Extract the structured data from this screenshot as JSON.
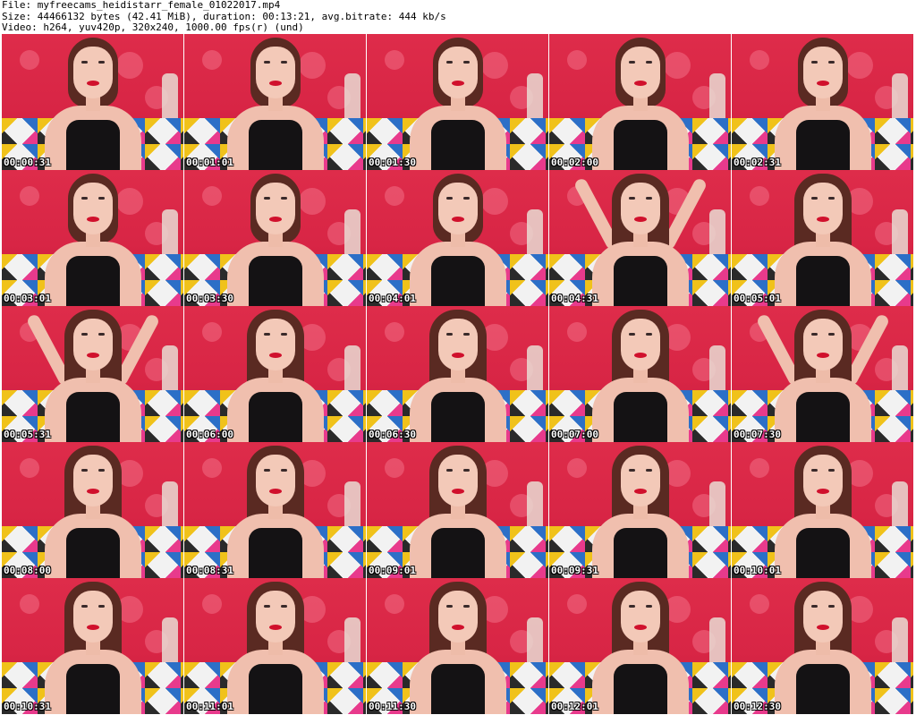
{
  "header": {
    "file_line": "File: myfreecams_heidistarr_female_01022017.mp4",
    "size_line": "Size: 44466132 bytes (42.41 MiB), duration: 00:13:21, avg.bitrate: 444 kb/s",
    "video_line": "Video: h264, yuv420p, 320x240, 1000.00 fps(r) (und)"
  },
  "thumbnails": [
    {
      "time": "00:00:31",
      "pose": "normal"
    },
    {
      "time": "00:01:01",
      "pose": "normal"
    },
    {
      "time": "00:01:30",
      "pose": "normal"
    },
    {
      "time": "00:02:00",
      "pose": "arm-head"
    },
    {
      "time": "00:02:31",
      "pose": "normal"
    },
    {
      "time": "00:03:01",
      "pose": "normal"
    },
    {
      "time": "00:03:30",
      "pose": "normal"
    },
    {
      "time": "00:04:01",
      "pose": "normal"
    },
    {
      "time": "00:04:31",
      "pose": "arms-up"
    },
    {
      "time": "00:05:01",
      "pose": "hair-down"
    },
    {
      "time": "00:05:31",
      "pose": "arms-up"
    },
    {
      "time": "00:06:00",
      "pose": "hair-down"
    },
    {
      "time": "00:06:30",
      "pose": "hair-down"
    },
    {
      "time": "00:07:00",
      "pose": "hair-down"
    },
    {
      "time": "00:07:30",
      "pose": "arms-up"
    },
    {
      "time": "00:08:00",
      "pose": "hair-down"
    },
    {
      "time": "00:08:31",
      "pose": "hair-down"
    },
    {
      "time": "00:09:01",
      "pose": "hair-down"
    },
    {
      "time": "00:09:31",
      "pose": "hair-down"
    },
    {
      "time": "00:10:01",
      "pose": "hair-down"
    },
    {
      "time": "00:10:31",
      "pose": "hair-down"
    },
    {
      "time": "00:11:01",
      "pose": "hair-down"
    },
    {
      "time": "00:11:30",
      "pose": "hair-down"
    },
    {
      "time": "00:12:01",
      "pose": "hair-down"
    },
    {
      "time": "00:12:30",
      "pose": "hair-down"
    }
  ],
  "colors": {
    "background": "#ffffff",
    "wall_red": "#d82545",
    "timestamp_text": "#ffffff",
    "timestamp_outline": "#000000"
  }
}
